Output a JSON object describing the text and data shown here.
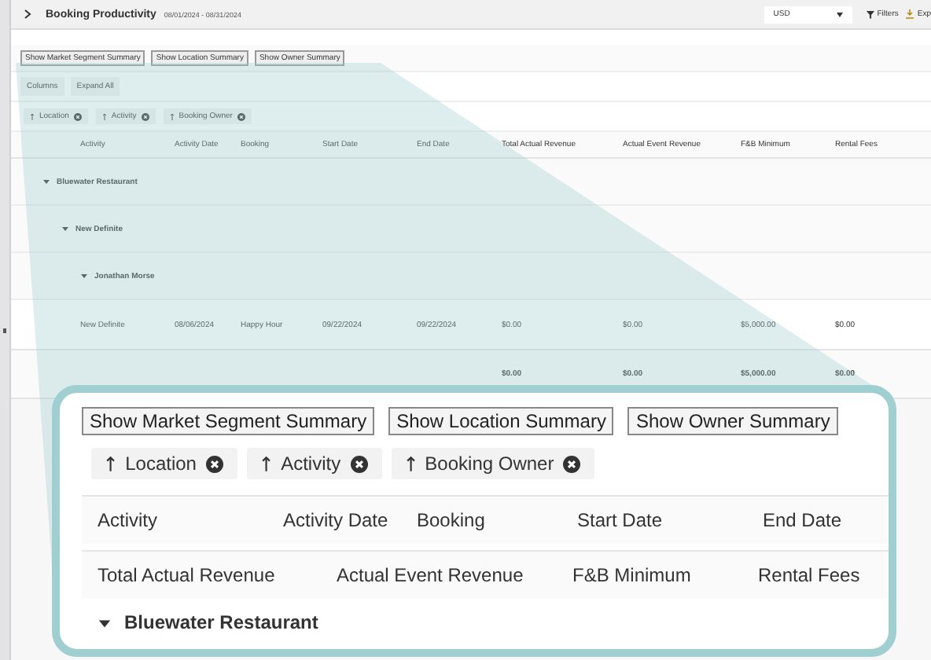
{
  "header": {
    "title": "Booking Productivity",
    "date_range": "08/01/2024 - 08/31/2024",
    "currency": "USD",
    "filters": "Filters",
    "export": "Exp"
  },
  "summary_buttons": [
    "Show Market Segment Summary",
    "Show Location Summary",
    "Show Owner Summary"
  ],
  "toolbar_buttons": [
    "Columns",
    "Expand All"
  ],
  "groupings": [
    {
      "label": "Location"
    },
    {
      "label": "Activity"
    },
    {
      "label": "Booking Owner"
    }
  ],
  "columns": [
    "Activity",
    "Activity Date",
    "Booking",
    "Start Date",
    "End Date",
    "Total Actual Revenue",
    "Actual Event Revenue",
    "F&B Minimum",
    "Rental Fees"
  ],
  "groups": [
    {
      "label": "Bluewater Restaurant",
      "expanded": true,
      "children": [
        {
          "label": "New Definite",
          "expanded": true,
          "children": [
            {
              "label": "Jonathan Morse",
              "expanded": true,
              "rows": [
                [
                  "New Definite",
                  "08/06/2024",
                  "Happy Hour",
                  "09/22/2024",
                  "09/22/2024",
                  "$0.00",
                  "$0.00",
                  "$5,000.00",
                  "$0.00"
                ]
              ]
            }
          ]
        }
      ]
    }
  ],
  "totals": [
    "$0.00",
    "$0.00",
    "$5,000.00",
    "$0.00"
  ],
  "callout": {
    "summary_buttons": [
      "Show Market Segment Summary",
      "Show Location Summary",
      "Show Owner Summary"
    ],
    "groupings": [
      {
        "label": "Location"
      },
      {
        "label": "Activity"
      },
      {
        "label": "Booking Owner"
      }
    ],
    "columns_row_1": [
      "Activity",
      "Activity Date",
      "Booking",
      "Start Date",
      "End Date"
    ],
    "columns_row_2": [
      "Total Actual Revenue",
      "Actual Event Revenue",
      "F&B Minimum",
      "Rental Fees"
    ],
    "group": {
      "label": "Bluewater Restaurant",
      "expanded": true
    }
  }
}
